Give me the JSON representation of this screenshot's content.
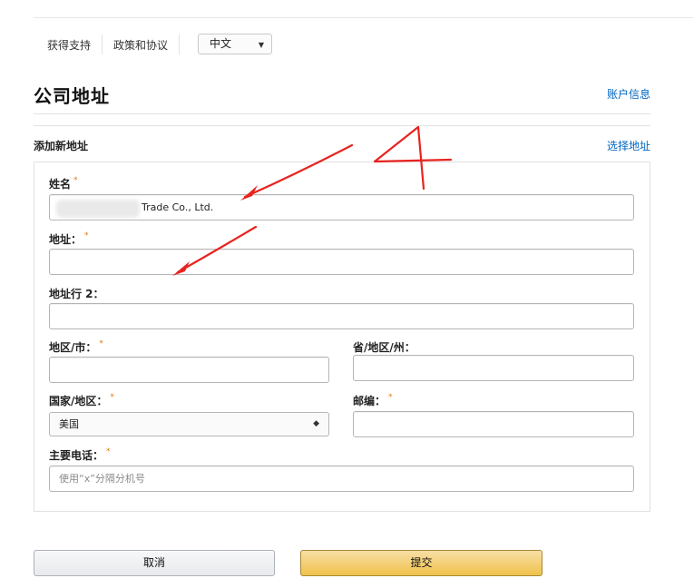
{
  "top_nav": {
    "links": [
      "获得支持",
      "政策和协议"
    ],
    "language": "中文"
  },
  "page": {
    "title": "公司地址",
    "account_link": "账户信息",
    "add_address": "添加新地址",
    "choose_address": "选择地址"
  },
  "form": {
    "required_mark": "*",
    "name": {
      "label": "姓名",
      "value_visible": "Trade Co., Ltd."
    },
    "address": {
      "label": "地址：",
      "value": ""
    },
    "address2": {
      "label": "地址行 2：",
      "value": ""
    },
    "city": {
      "label": "地区/市：",
      "value": ""
    },
    "state": {
      "label": "省/地区/州：",
      "value": ""
    },
    "country": {
      "label": "国家/地区：",
      "value": "美国"
    },
    "postal": {
      "label": "邮编：",
      "value": ""
    },
    "phone": {
      "label": "主要电话：",
      "placeholder": "使用“x”分隔分机号"
    }
  },
  "buttons": {
    "cancel": "取消",
    "submit": "提交"
  },
  "annotation": {
    "number": "4",
    "color": "#e8231f"
  },
  "colors": {
    "link": "#0066c0",
    "required": "#e47911",
    "submit_bg": "#f0c14b"
  },
  "icons": {
    "language_caret": "dropdown-caret-icon",
    "country_select": "up-down-arrows-icon"
  }
}
